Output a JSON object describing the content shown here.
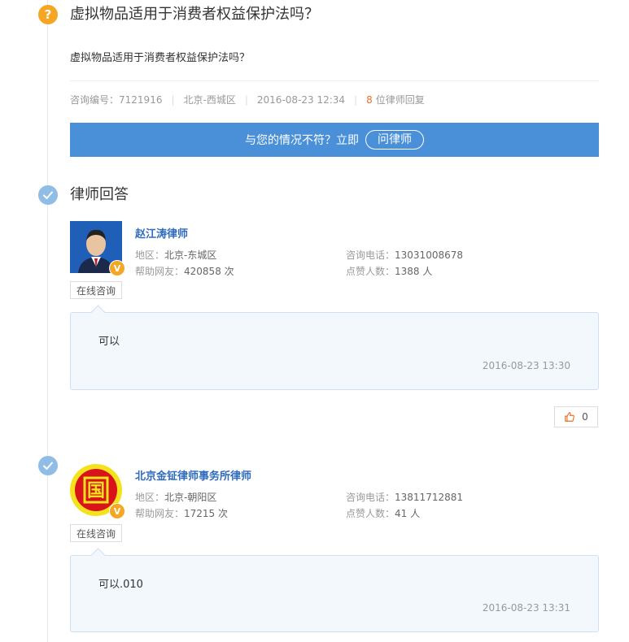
{
  "question": {
    "icon": "?",
    "title": "虚拟物品适用于消费者权益保护法吗？",
    "body": "虚拟物品适用于消费者权益保护法吗？",
    "meta": {
      "id_label": "咨询编号：",
      "id": "7121916",
      "location": "北京-西城区",
      "datetime": "2016-08-23 12:34",
      "reply_count": "8",
      "reply_suffix": "位律师回复"
    },
    "ask_bar": {
      "text": "与您的情况不符？立即",
      "button": "问律师"
    }
  },
  "section_title": "律师回答",
  "labels": {
    "region": "地区：",
    "helped": "帮助网友：",
    "phone": "咨询电话：",
    "likes": "点赞人数：",
    "consult_button": "在线咨询",
    "badge": "V"
  },
  "answers": [
    {
      "lawyer_name": "赵江涛律师",
      "region": "北京-东城区",
      "helped": "420858 次",
      "phone": "13031008678",
      "likes": "1388 人",
      "answer": "可以",
      "time": "2016-08-23 13:30",
      "like_count": "0"
    },
    {
      "lawyer_name": "北京金钲律师事务所律师",
      "avatar_char": "国",
      "region": "北京-朝阳区",
      "helped": "17215 次",
      "phone": "13811712881",
      "likes": "41 人",
      "answer": "可以.010",
      "time": "2016-08-23 13:31"
    }
  ],
  "colors": {
    "accent_blue": "#4a90d9",
    "link_blue": "#2e6bbd",
    "orange": "#f5a623",
    "count_orange": "#e8702a"
  }
}
